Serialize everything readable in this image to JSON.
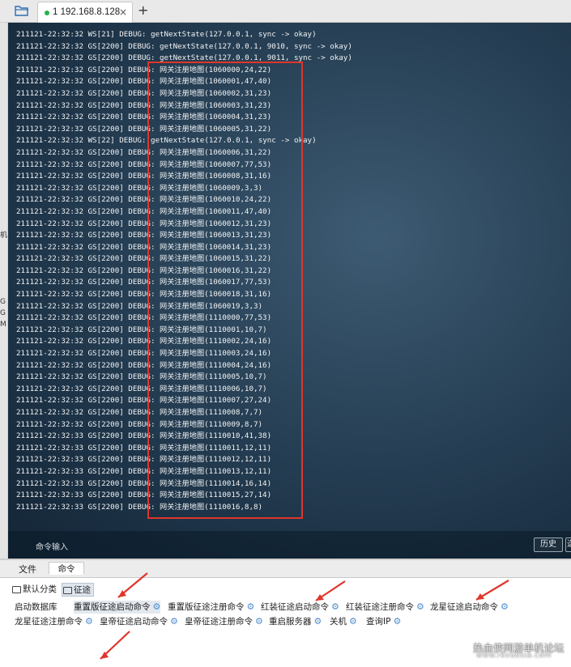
{
  "session_tab": {
    "label": "1 192.168.8.128",
    "close": "×",
    "add": "+"
  },
  "left_strip_chars": [
    "机",
    "G",
    "G",
    "M"
  ],
  "terminal": {
    "lines": [
      "211121-22:32:32 WS[21] DEBUG: getNextState(127.0.0.1, sync -> okay)",
      "211121-22:32:32 GS[2200] DEBUG: getNextState(127.0.0.1, 9010, sync -> okay)",
      "211121-22:32:32 GS[2200] DEBUG: getNextState(127.0.0.1, 9011, sync -> okay)",
      "211121-22:32:32 GS[2200] DEBUG: 网关注册地图(1060000,24,22)",
      "211121-22:32:32 GS[2200] DEBUG: 网关注册地图(1060001,47,40)",
      "211121-22:32:32 GS[2200] DEBUG: 网关注册地图(1060002,31,23)",
      "211121-22:32:32 GS[2200] DEBUG: 网关注册地图(1060003,31,23)",
      "211121-22:32:32 GS[2200] DEBUG: 网关注册地图(1060004,31,23)",
      "211121-22:32:32 GS[2200] DEBUG: 网关注册地图(1060005,31,22)",
      "211121-22:32:32 WS[22] DEBUG: getNextState(127.0.0.1, sync -> okay)",
      "211121-22:32:32 GS[2200] DEBUG: 网关注册地图(1060006,31,22)",
      "211121-22:32:32 GS[2200] DEBUG: 网关注册地图(1060007,77,53)",
      "211121-22:32:32 GS[2200] DEBUG: 网关注册地图(1060008,31,16)",
      "211121-22:32:32 GS[2200] DEBUG: 网关注册地图(1060009,3,3)",
      "211121-22:32:32 GS[2200] DEBUG: 网关注册地图(1060010,24,22)",
      "211121-22:32:32 GS[2200] DEBUG: 网关注册地图(1060011,47,40)",
      "211121-22:32:32 GS[2200] DEBUG: 网关注册地图(1060012,31,23)",
      "211121-22:32:32 GS[2200] DEBUG: 网关注册地图(1060013,31,23)",
      "211121-22:32:32 GS[2200] DEBUG: 网关注册地图(1060014,31,23)",
      "211121-22:32:32 GS[2200] DEBUG: 网关注册地图(1060015,31,22)",
      "211121-22:32:32 GS[2200] DEBUG: 网关注册地图(1060016,31,22)",
      "211121-22:32:32 GS[2200] DEBUG: 网关注册地图(1060017,77,53)",
      "211121-22:32:32 GS[2200] DEBUG: 网关注册地图(1060018,31,16)",
      "211121-22:32:32 GS[2200] DEBUG: 网关注册地图(1060019,3,3)",
      "211121-22:32:32 GS[2200] DEBUG: 网关注册地图(1110000,77,53)",
      "211121-22:32:32 GS[2200] DEBUG: 网关注册地图(1110001,10,7)",
      "211121-22:32:32 GS[2200] DEBUG: 网关注册地图(1110002,24,16)",
      "211121-22:32:32 GS[2200] DEBUG: 网关注册地图(1110003,24,16)",
      "211121-22:32:32 GS[2200] DEBUG: 网关注册地图(1110004,24,16)",
      "211121-22:32:32 GS[2200] DEBUG: 网关注册地图(1110005,10,7)",
      "211121-22:32:32 GS[2200] DEBUG: 网关注册地图(1110006,10,7)",
      "211121-22:32:32 GS[2200] DEBUG: 网关注册地图(1110007,27,24)",
      "211121-22:32:32 GS[2200] DEBUG: 网关注册地图(1110008,7,7)",
      "211121-22:32:32 GS[2200] DEBUG: 网关注册地图(1110009,8,7)",
      "211121-22:32:33 GS[2200] DEBUG: 网关注册地图(1110010,41,38)",
      "211121-22:32:33 GS[2200] DEBUG: 网关注册地图(1110011,12,11)",
      "211121-22:32:33 GS[2200] DEBUG: 网关注册地图(1110012,12,11)",
      "211121-22:32:33 GS[2200] DEBUG: 网关注册地图(1110013,12,11)",
      "211121-22:32:33 GS[2200] DEBUG: 网关注册地图(1110014,16,14)",
      "211121-22:32:33 GS[2200] DEBUG: 网关注册地图(1110015,27,14)",
      "211121-22:32:33 GS[2200] DEBUG: 网关注册地图(1110016,8,8)"
    ],
    "command_placeholder": "命令输入",
    "history_button": "历史",
    "extra_button": "选"
  },
  "bottom_tabs": {
    "file": "文件",
    "command": "命令"
  },
  "categories": [
    {
      "label": "默认分类",
      "selected": false
    },
    {
      "label": "征途",
      "selected": true
    }
  ],
  "commands": [
    {
      "label": "启动数据库",
      "gear": false,
      "selected": false
    },
    {
      "label": "重置版征途启动命令",
      "gear": true,
      "selected": true
    },
    {
      "label": "重置版征途注册命令",
      "gear": true,
      "selected": false
    },
    {
      "label": "红装征途启动命令",
      "gear": true,
      "selected": false
    },
    {
      "label": "红装征途注册命令",
      "gear": true,
      "selected": false
    },
    {
      "label": "龙星征途启动命令",
      "gear": true,
      "selected": false
    },
    {
      "label": "龙星征途注册命令",
      "gear": true,
      "selected": false
    },
    {
      "label": "皇帝征途启动命令",
      "gear": true,
      "selected": false
    },
    {
      "label": "皇帝征途注册命令",
      "gear": true,
      "selected": false
    },
    {
      "label": "重启服务器",
      "gear": true,
      "selected": false
    },
    {
      "label": "关机",
      "gear": true,
      "selected": false
    },
    {
      "label": "查询IP",
      "gear": true,
      "selected": false
    }
  ],
  "watermark": {
    "main": "热血侠网游单机论坛",
    "sub": "www.rexuexia.com"
  },
  "colors": {
    "highlight_box": "#e0352b",
    "gear": "#4f8fcf",
    "status_dot": "#26b34a"
  }
}
